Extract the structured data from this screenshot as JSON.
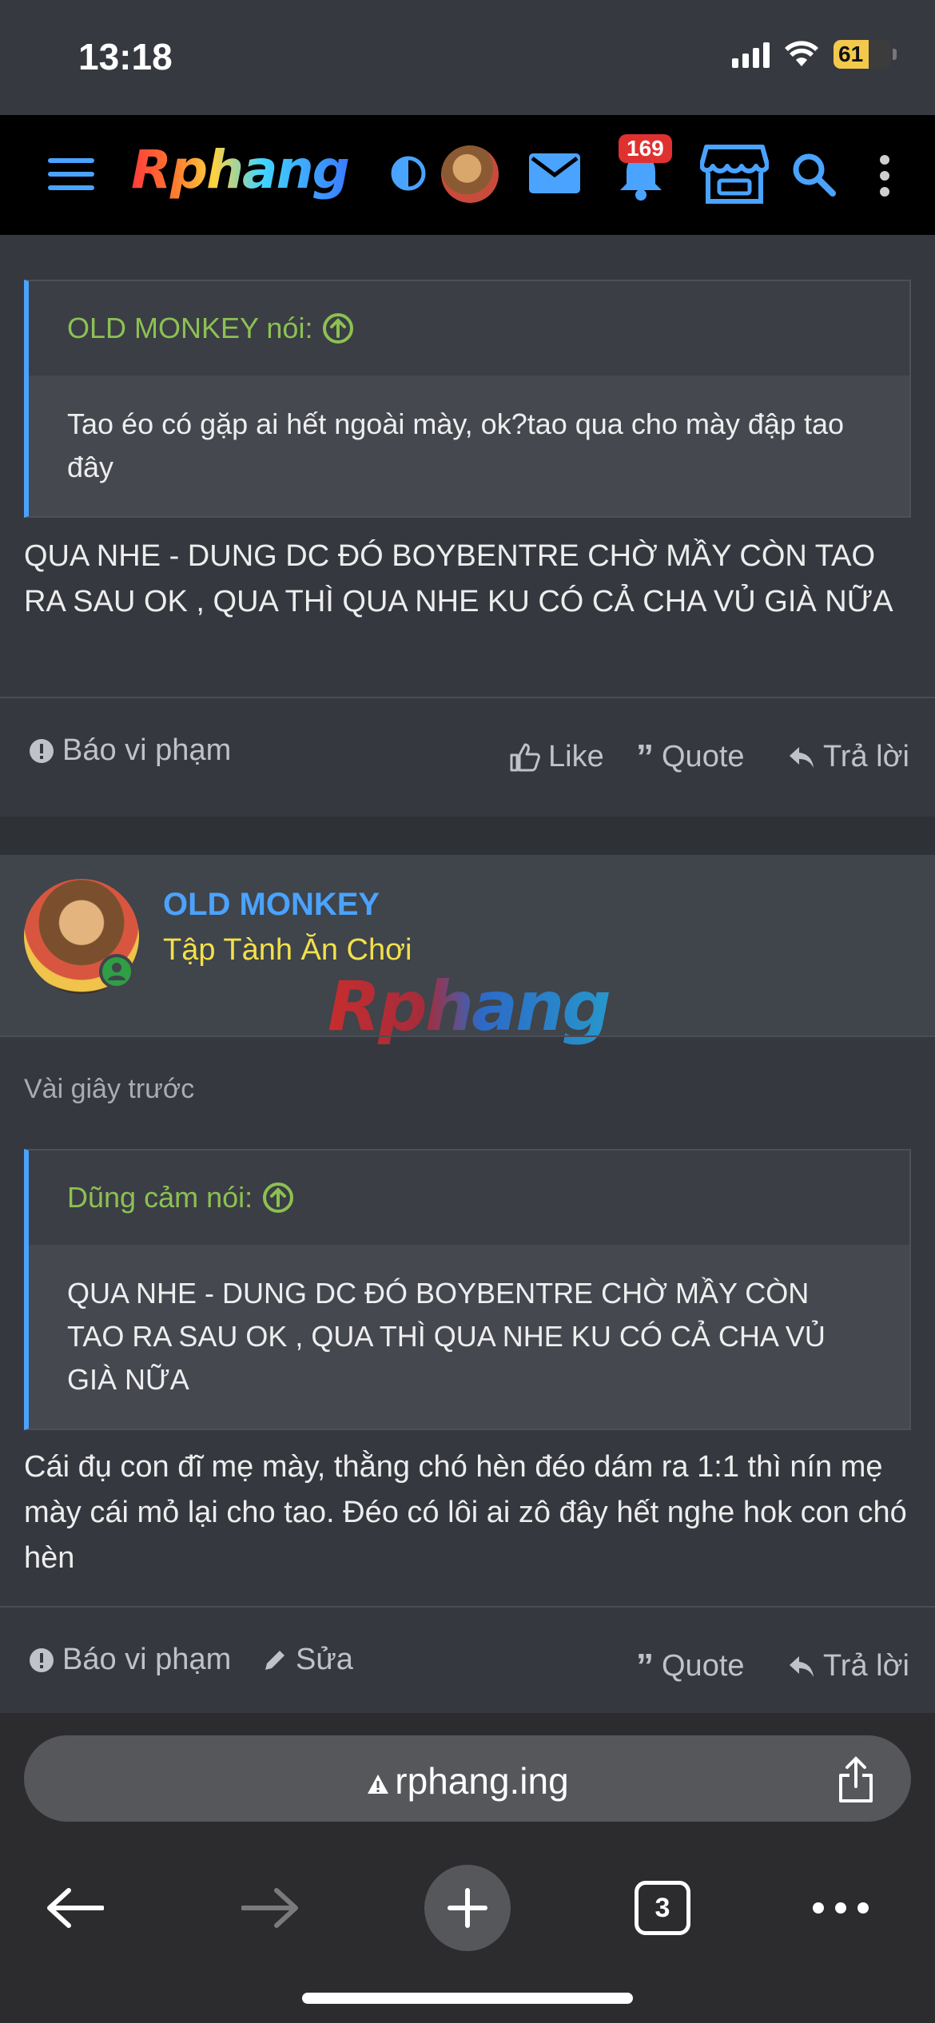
{
  "status_bar": {
    "time": "13:18",
    "battery": "61"
  },
  "nav": {
    "logo": "Rphang",
    "notification_count": "169"
  },
  "post1": {
    "quote_author": "OLD MONKEY nói:",
    "quote_text": "Tao éo có gặp ai hết ngoài mày, ok?tao qua cho mày đập tao đây",
    "text": "QUA NHE - DUNG DC ĐÓ BOYBENTRE CHỜ MẦY CÒN TAO RA SAU OK , QUA THÌ QUA NHE KU CÓ CẢ CHA VỦ GIÀ NỮA",
    "actions": {
      "report": "Báo vi phạm",
      "like": "Like",
      "quote": "Quote",
      "reply": "Trả lời"
    }
  },
  "post2": {
    "username": "OLD MONKEY",
    "user_title": "Tập Tành Ăn Chơi",
    "watermark": "Rphang",
    "timestamp": "Vài giây trước",
    "quote_author": "Dũng cảm nói:",
    "quote_text": "QUA NHE - DUNG DC ĐÓ BOYBENTRE CHỜ MẦY CÒN TAO RA SAU OK , QUA THÌ QUA NHE KU CÓ CẢ CHA VỦ GIÀ NỮA",
    "text": "Cái đụ con đĩ mẹ mày, thằng chó hèn đéo dám ra 1:1 thì nín mẹ mày cái mỏ lại cho tao. Đéo có lôi ai zô đây hết nghe hok con chó hèn",
    "actions": {
      "report": "Báo vi phạm",
      "edit": "Sửa",
      "quote": "Quote",
      "reply": "Trả lời"
    }
  },
  "browser": {
    "url": "rphang.ing",
    "tab_count": "3"
  },
  "colors": {
    "link_blue": "#4aa3ff",
    "quote_green": "#8cc152",
    "title_yellow": "#f2e14a",
    "badge_red": "#e03131"
  },
  "icons": [
    "menu-icon",
    "theme-toggle-icon",
    "mail-icon",
    "bell-icon",
    "store-icon",
    "search-icon",
    "more-vertical-icon",
    "report-icon",
    "like-icon",
    "quote-icon",
    "reply-icon",
    "edit-icon",
    "lock-warning-icon",
    "share-icon",
    "back-icon",
    "forward-icon",
    "new-tab-icon",
    "tabs-icon",
    "more-horizontal-icon"
  ]
}
